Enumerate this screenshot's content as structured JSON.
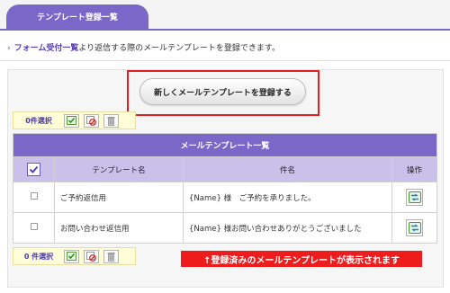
{
  "header": {
    "tab_title": "テンプレート登録一覧"
  },
  "description": {
    "arrow": "›",
    "link_text": "フォーム受付一覧",
    "rest_text": "より返信する際のメールテンプレートを登録できます。"
  },
  "new_button_label": "新しくメールテンプレートを登録する",
  "selection_top": {
    "count_label": "0件選択"
  },
  "selection_bottom": {
    "count_label": "0 件選択"
  },
  "table": {
    "caption": "メールテンプレート一覧",
    "headers": {
      "name": "テンプレート名",
      "subject": "件名",
      "action": "操作"
    },
    "rows": [
      {
        "name": "ご予約返信用",
        "subject": "{Name} 様　ご予約を承りました。"
      },
      {
        "name": "お問い合わせ返信用",
        "subject": "{Name} 様お問い合わせありがとうございました"
      }
    ]
  },
  "annotation": "↑登録済みのメールテンプレートが表示されます",
  "icons": {
    "check": "check-all-icon",
    "uncheck": "uncheck-all-icon",
    "trash": "trash-icon",
    "edit": "edit-icon"
  },
  "colors": {
    "accent": "#7b67c8",
    "header_row": "#c9c1ea",
    "selection_bg": "#fffdd8",
    "highlight": "#e02020"
  }
}
